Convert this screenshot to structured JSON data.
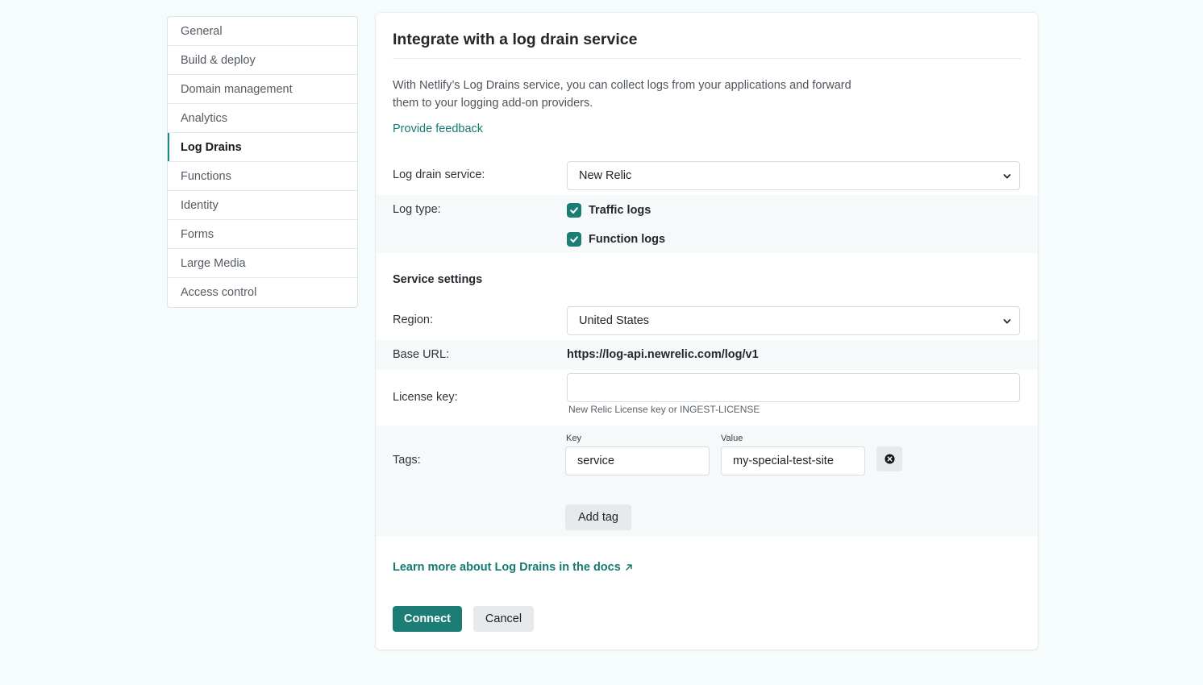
{
  "sidebar": {
    "items": [
      {
        "label": "General"
      },
      {
        "label": "Build & deploy"
      },
      {
        "label": "Domain management"
      },
      {
        "label": "Analytics"
      },
      {
        "label": "Log Drains",
        "active": true
      },
      {
        "label": "Functions"
      },
      {
        "label": "Identity"
      },
      {
        "label": "Forms"
      },
      {
        "label": "Large Media"
      },
      {
        "label": "Access control"
      }
    ]
  },
  "card": {
    "title": "Integrate with a log drain service",
    "description": "With Netlify’s Log Drains service, you can collect logs from your applications and forward them to your logging add-on providers.",
    "feedback_link": "Provide feedback",
    "service": {
      "label": "Log drain service:",
      "value": "New Relic"
    },
    "log_type": {
      "label": "Log type:",
      "options": [
        {
          "label": "Traffic logs",
          "checked": true
        },
        {
          "label": "Function logs",
          "checked": true
        }
      ]
    },
    "settings_title": "Service settings",
    "region": {
      "label": "Region:",
      "value": "United States"
    },
    "base_url": {
      "label": "Base URL:",
      "value": "https://log-api.newrelic.com/log/v1"
    },
    "license_key": {
      "label": "License key:",
      "value": "",
      "helper": "New Relic License key or INGEST-LICENSE"
    },
    "tags": {
      "label": "Tags:",
      "key_label": "Key",
      "value_label": "Value",
      "rows": [
        {
          "key": "service",
          "value": "my-special-test-site"
        }
      ],
      "add_label": "Add tag"
    },
    "docs_link": "Learn more about Log Drains in the docs",
    "connect_label": "Connect",
    "cancel_label": "Cancel"
  },
  "colors": {
    "accent": "#1b7d74",
    "link": "#157a70",
    "background": "#f6fbfb"
  }
}
